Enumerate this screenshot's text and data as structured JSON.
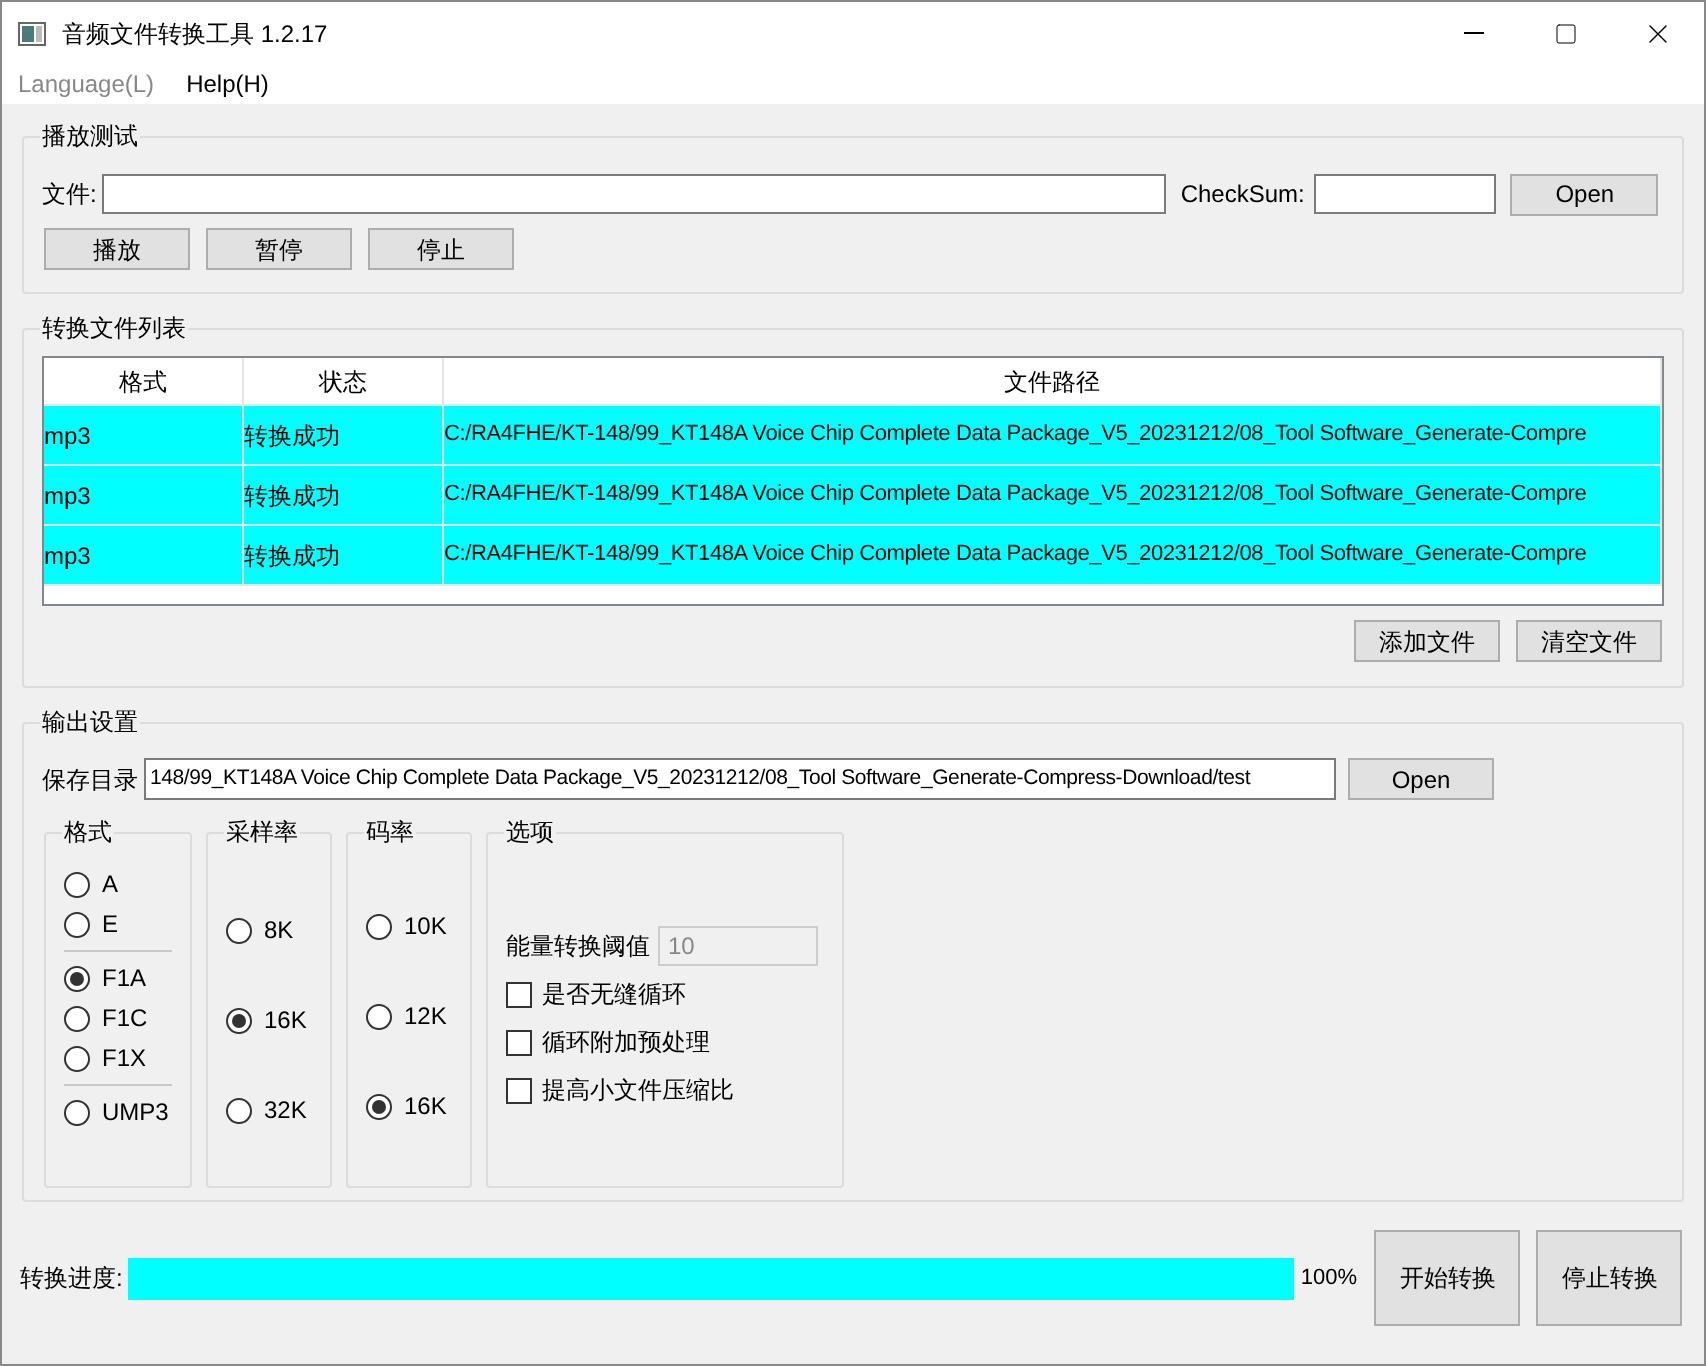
{
  "window": {
    "title": "音频文件转换工具 1.2.17"
  },
  "menu": [
    {
      "label": "Language(L)",
      "disabled": true
    },
    {
      "label": "Help(H)",
      "disabled": false
    }
  ],
  "play_test": {
    "title": "播放测试",
    "file_label": "文件:",
    "checksum_label": "CheckSum:",
    "open_button": "Open",
    "buttons": [
      "播放",
      "暂停",
      "停止"
    ]
  },
  "file_list": {
    "title": "转换文件列表",
    "columns": [
      "格式",
      "状态",
      "文件路径"
    ],
    "rows": [
      {
        "cells": [
          "mp3",
          "转换成功",
          "C:/RA4FHE/KT-148/99_KT148A Voice Chip Complete Data Package_V5_20231212/08_Tool Software_Generate-Compre"
        ],
        "selected": true
      },
      {
        "cells": [
          "mp3",
          "转换成功",
          "C:/RA4FHE/KT-148/99_KT148A Voice Chip Complete Data Package_V5_20231212/08_Tool Software_Generate-Compre"
        ],
        "selected": true
      },
      {
        "cells": [
          "mp3",
          "转换成功",
          "C:/RA4FHE/KT-148/99_KT148A Voice Chip Complete Data Package_V5_20231212/08_Tool Software_Generate-Compre"
        ],
        "selected": true
      }
    ],
    "buttons": [
      "添加文件",
      "清空文件"
    ]
  },
  "output": {
    "title": "输出设置",
    "save_label": "保存目录",
    "save_value": "148/99_KT148A Voice Chip Complete Data Package_V5_20231212/08_Tool Software_Generate-Compress-Download/test",
    "open_button": "Open",
    "format": {
      "title": "格式",
      "options": [
        {
          "label": "A",
          "selected": false,
          "divider_before": false
        },
        {
          "label": "E",
          "selected": false,
          "divider_before": false
        },
        {
          "label": "F1A",
          "selected": true,
          "divider_before": true
        },
        {
          "label": "F1C",
          "selected": false,
          "divider_before": false
        },
        {
          "label": "F1X",
          "selected": false,
          "divider_before": false
        },
        {
          "label": "UMP3",
          "selected": false,
          "divider_before": true
        }
      ]
    },
    "sample_rate": {
      "title": "采样率",
      "options": [
        {
          "label": "8K",
          "selected": false
        },
        {
          "label": "16K",
          "selected": true
        },
        {
          "label": "32K",
          "selected": false
        }
      ]
    },
    "bit_rate": {
      "title": "码率",
      "options": [
        {
          "label": "10K",
          "selected": false
        },
        {
          "label": "12K",
          "selected": false
        },
        {
          "label": "16K",
          "selected": true
        }
      ]
    },
    "options": {
      "title": "选项",
      "threshold_label": "能量转换阈值",
      "threshold_value": "10",
      "threshold_disabled": true,
      "checkboxes": [
        {
          "label": "是否无缝循环",
          "checked": false
        },
        {
          "label": "循环附加预处理",
          "checked": false
        },
        {
          "label": "提高小文件压缩比",
          "checked": false
        }
      ]
    }
  },
  "progress": {
    "label": "转换进度:",
    "level": 1,
    "reading": "100%",
    "buttons": [
      "开始转换",
      "停止转换"
    ]
  }
}
